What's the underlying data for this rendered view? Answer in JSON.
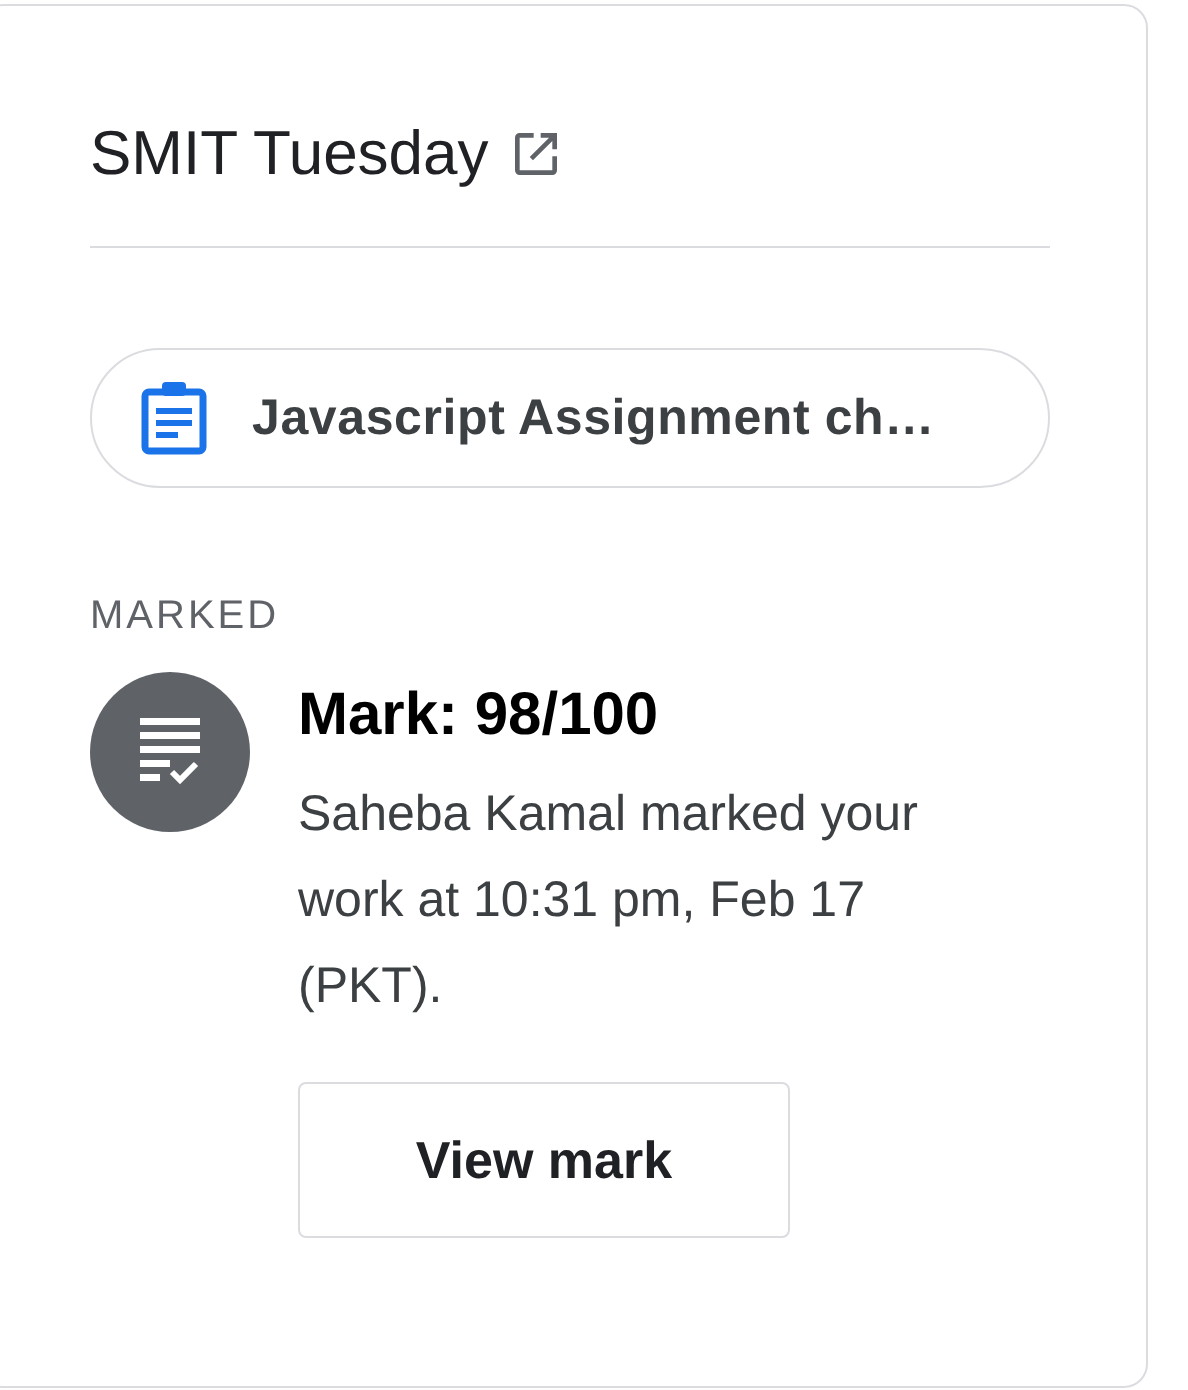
{
  "class": {
    "title": "SMIT Tuesday"
  },
  "attachment": {
    "title": "Javascript Assignment ch…"
  },
  "status": {
    "label": "MARKED",
    "heading": "Mark: 98/100",
    "description": "Saheba Kamal marked your work at 10:31 pm, Feb 17 (PKT).",
    "button": "View mark"
  }
}
